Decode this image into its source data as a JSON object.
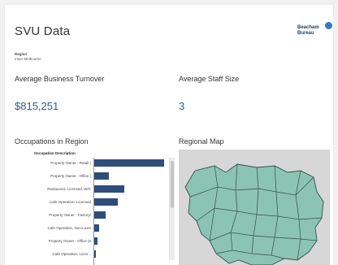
{
  "header": {
    "title": "SVU Data",
    "logo_text_line1": "Beacham",
    "logo_text_line2": "Bureau"
  },
  "filter": {
    "label": "Region",
    "value": "Inner Melbourne"
  },
  "kpis": [
    {
      "label": "Average Business Turnover",
      "value": "$815,251"
    },
    {
      "label": "Average Staff Size",
      "value": "3"
    }
  ],
  "occupations": {
    "title": "Occupations in Region",
    "column_header": "Occupation Description",
    "bar_color": "#2e4d7b",
    "rows": [
      {
        "label": "Property Owner - Retail (",
        "value": 0.98
      },
      {
        "label": "Property Owner - Office (",
        "value": 0.21
      },
      {
        "label": "Restaurant, Licensed, W/C",
        "value": 0.42
      },
      {
        "label": "Cafe Operation, Licensed",
        "value": 0.33
      },
      {
        "label": "Property Owner - Factory/",
        "value": 0.16
      },
      {
        "label": "Cafe Operation, Non-Licen",
        "value": 0.07
      },
      {
        "label": "Property Owner - Office (5",
        "value": 0.04
      },
      {
        "label": "Cafe Operation, Licen...",
        "value": 0.02
      }
    ]
  },
  "map": {
    "title": "Regional Map",
    "region_fill": "#8cc4b3",
    "region_stroke": "#2f4f4a",
    "background": "#d7d7d7"
  }
}
